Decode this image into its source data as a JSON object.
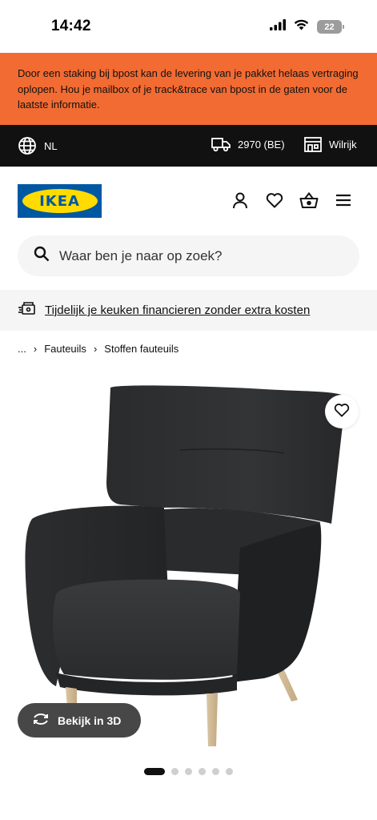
{
  "status_bar": {
    "time": "14:42",
    "icons": [
      "signal-icon",
      "wifi-icon",
      "battery-icon"
    ],
    "battery_level": "22"
  },
  "banner": {
    "text": "Door een staking bij bpost kan de levering van je pakket helaas vertraging oplopen. Hou je mailbox of je track&trace van bpost in de gaten voor de laatste informatie.",
    "background": "#f26b32"
  },
  "utility_bar": {
    "language": "NL",
    "delivery_location": "2970 (BE)",
    "store": "Wilrijk",
    "icons": [
      "globe-icon",
      "truck-icon",
      "store-icon"
    ]
  },
  "header": {
    "logo_text": "IKEA",
    "logo_colors": {
      "blue": "#0058a3",
      "yellow": "#ffdb00"
    },
    "icons": [
      "user-icon",
      "heart-icon",
      "basket-icon",
      "menu-icon"
    ]
  },
  "search": {
    "placeholder": "Waar ben je naar op zoek?"
  },
  "promo": {
    "text": "Tijdelijk je keuken financieren zonder extra kosten"
  },
  "breadcrumb": {
    "ellipsis": "...",
    "items": [
      "Fauteuils",
      "Stoffen fauteuils"
    ]
  },
  "product": {
    "image_alt": "dark grey fabric wing chair with light wooden legs",
    "view_3d_label": "Bekijk in 3D",
    "carousel": {
      "total": 6,
      "active": 1
    }
  }
}
